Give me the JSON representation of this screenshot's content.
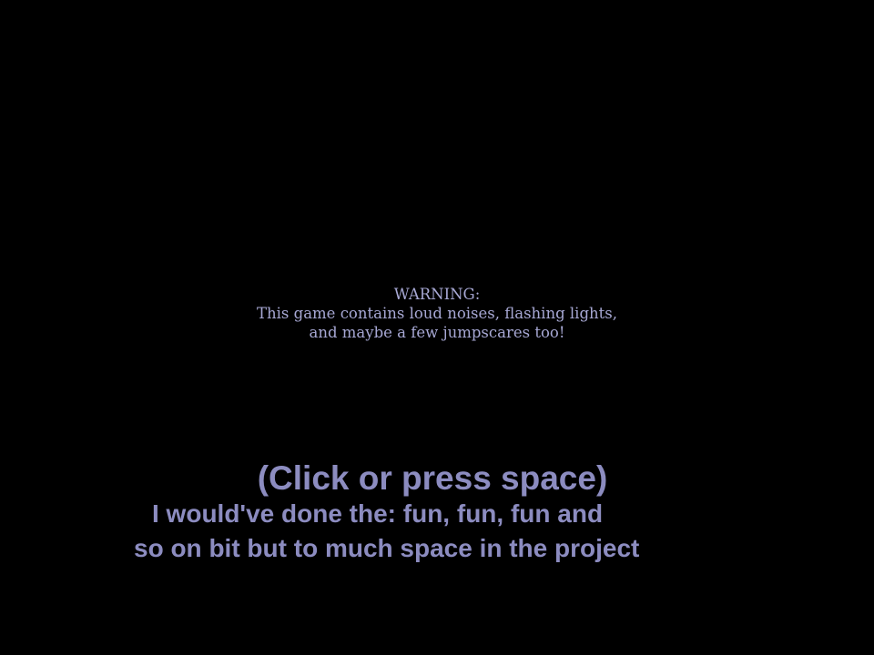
{
  "warning": {
    "heading": "WARNING:",
    "line1": "This game contains loud noises, flashing lights,",
    "line2": "and maybe a few jumpscares too!"
  },
  "prompt": "(Click or press space)",
  "note": {
    "line1": "I would've done the: fun, fun, fun and",
    "line2": "so on bit but to much space in the project"
  },
  "colors": {
    "background": "#000000",
    "warning_text": "#a7a8d4",
    "prompt_text": "#8c8cc0"
  }
}
